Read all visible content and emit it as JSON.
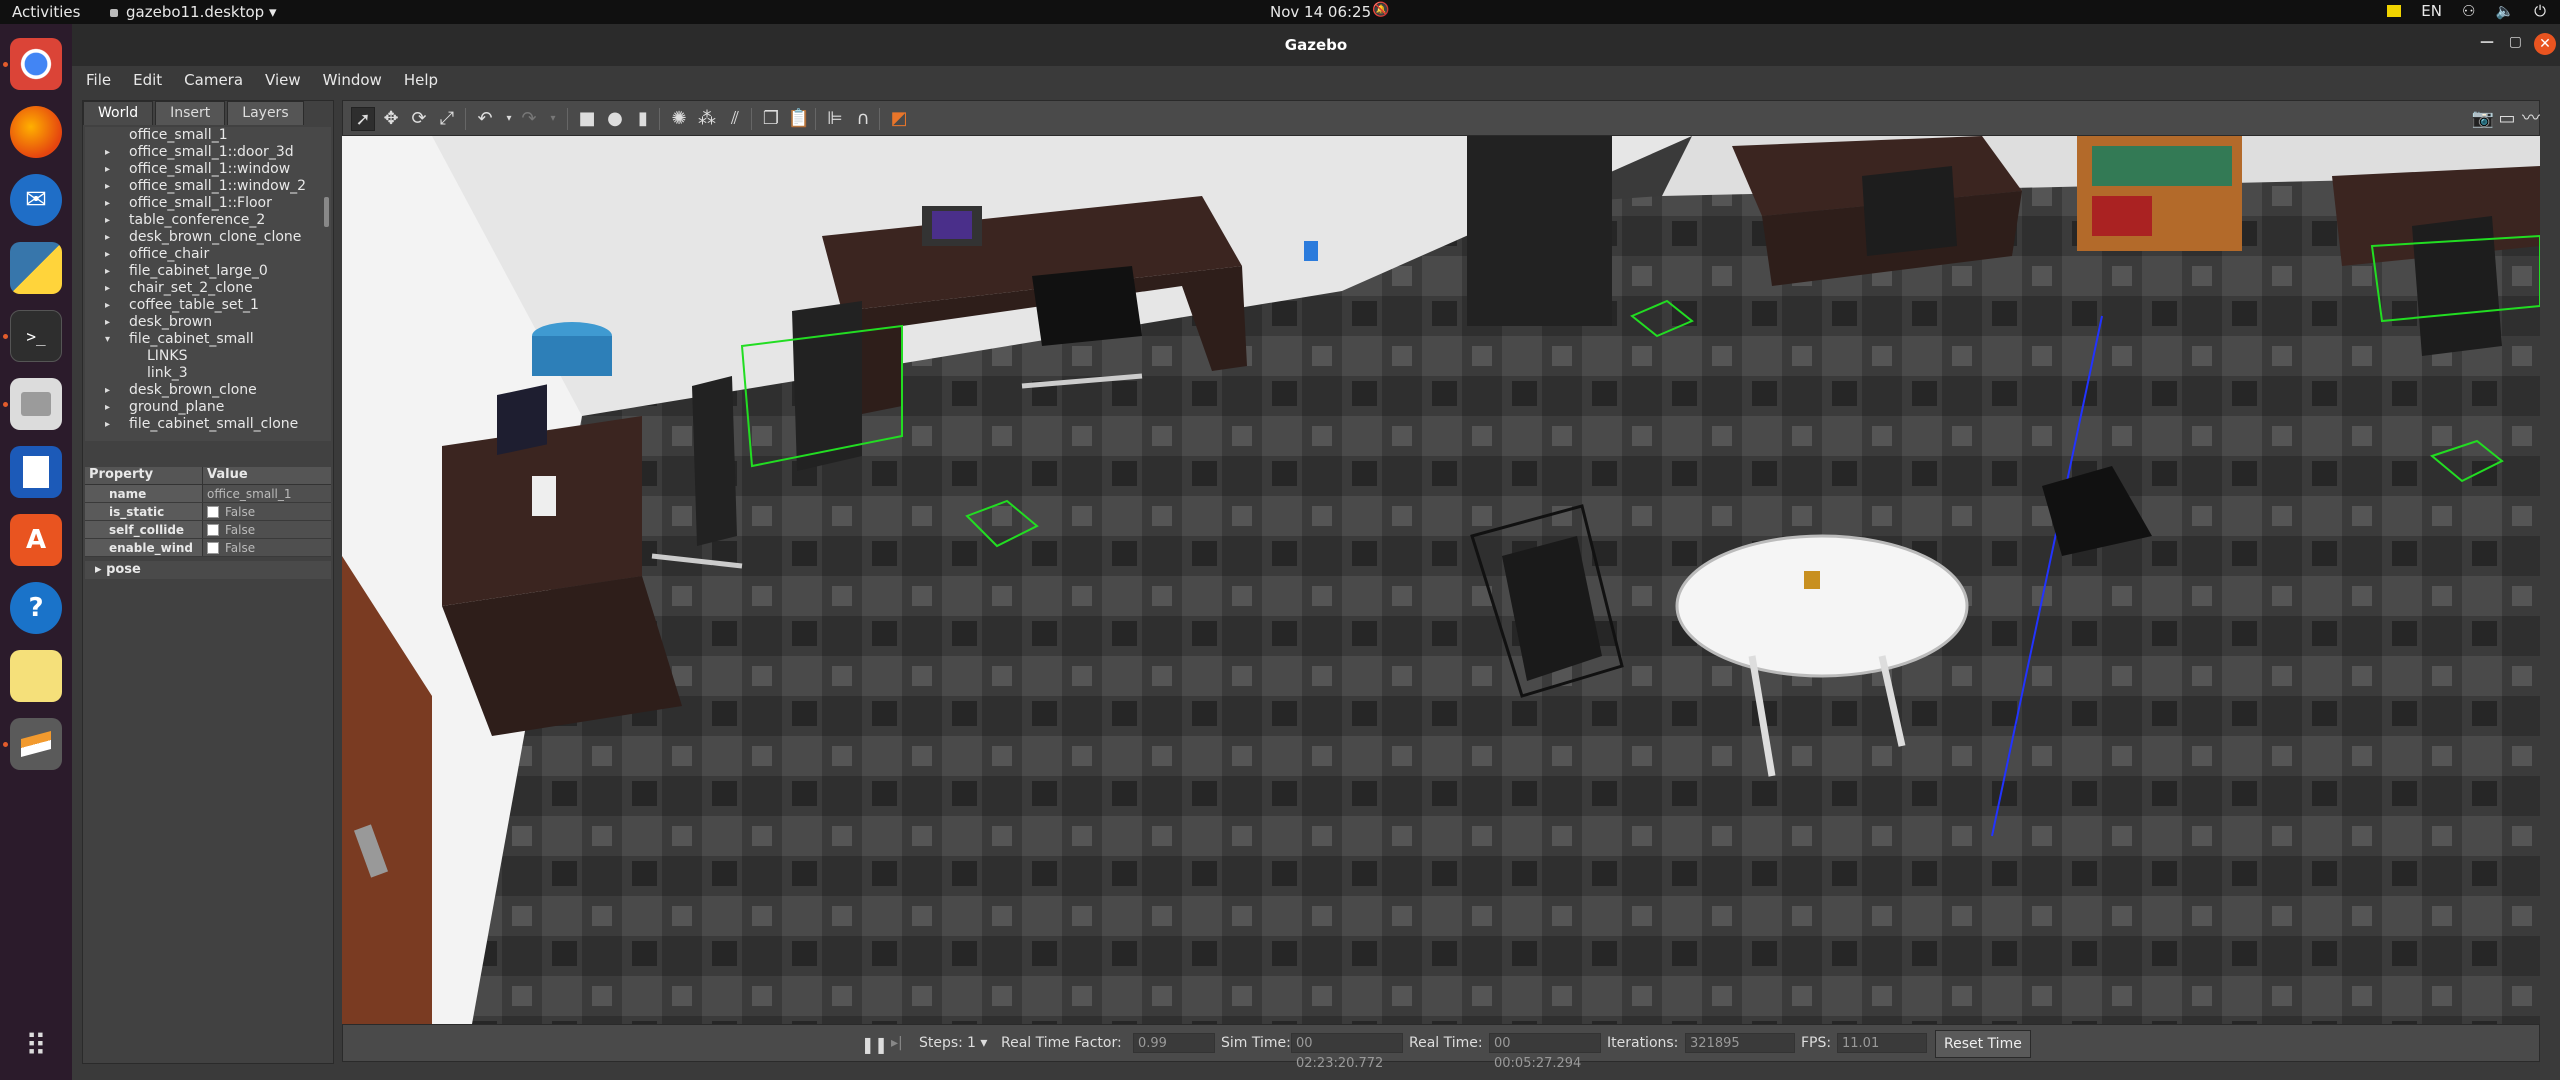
{
  "topbar": {
    "activities": "Activities",
    "app_name": "gazebo11.desktop",
    "clock": "Nov 14  06:25",
    "lang": "EN"
  },
  "window": {
    "title": "Gazebo"
  },
  "menu": [
    "File",
    "Edit",
    "Camera",
    "View",
    "Window",
    "Help"
  ],
  "tabs": [
    "World",
    "Insert",
    "Layers"
  ],
  "tree": [
    {
      "label": "office_small_1",
      "arrow": false,
      "indent": 0
    },
    {
      "label": "office_small_1::door_3d",
      "arrow": true,
      "indent": 0
    },
    {
      "label": "office_small_1::window",
      "arrow": true,
      "indent": 0
    },
    {
      "label": "office_small_1::window_2",
      "arrow": true,
      "indent": 0
    },
    {
      "label": "office_small_1::Floor",
      "arrow": true,
      "indent": 0
    },
    {
      "label": "table_conference_2",
      "arrow": true,
      "indent": 0
    },
    {
      "label": "desk_brown_clone_clone",
      "arrow": true,
      "indent": 0
    },
    {
      "label": "office_chair",
      "arrow": true,
      "indent": 0
    },
    {
      "label": "file_cabinet_large_0",
      "arrow": true,
      "indent": 0
    },
    {
      "label": "chair_set_2_clone",
      "arrow": true,
      "indent": 0
    },
    {
      "label": "coffee_table_set_1",
      "arrow": true,
      "indent": 0
    },
    {
      "label": "desk_brown",
      "arrow": true,
      "indent": 0
    },
    {
      "label": "file_cabinet_small",
      "arrow": true,
      "expanded": true,
      "indent": 0
    },
    {
      "label": "LINKS",
      "arrow": false,
      "indent": 1
    },
    {
      "label": "link_3",
      "arrow": false,
      "indent": 1
    },
    {
      "label": "desk_brown_clone",
      "arrow": true,
      "indent": 0
    },
    {
      "label": "ground_plane",
      "arrow": true,
      "indent": 0
    },
    {
      "label": "file_cabinet_small_clone",
      "arrow": true,
      "indent": 0
    }
  ],
  "props": {
    "head_property": "Property",
    "head_value": "Value",
    "rows": [
      {
        "key": "name",
        "value": "office_small_1",
        "checkbox": false
      },
      {
        "key": "is_static",
        "value": "False",
        "checkbox": true
      },
      {
        "key": "self_collide",
        "value": "False",
        "checkbox": true
      },
      {
        "key": "enable_wind",
        "value": "False",
        "checkbox": true
      }
    ],
    "pose": "pose"
  },
  "status": {
    "steps_label": "Steps:",
    "steps_value": "1",
    "rtf_label": "Real Time Factor:",
    "rtf_value": "0.99",
    "sim_label": "Sim Time:",
    "sim_value": "00 02:23:20.772",
    "real_label": "Real Time:",
    "real_value": "00 00:05:27.294",
    "iter_label": "Iterations:",
    "iter_value": "321895",
    "fps_label": "FPS:",
    "fps_value": "11.01",
    "reset": "Reset Time"
  },
  "colors": {
    "accent": "#e95420",
    "selection_green": "#22dd22",
    "viewport_carpet": "#3c3c3c"
  }
}
